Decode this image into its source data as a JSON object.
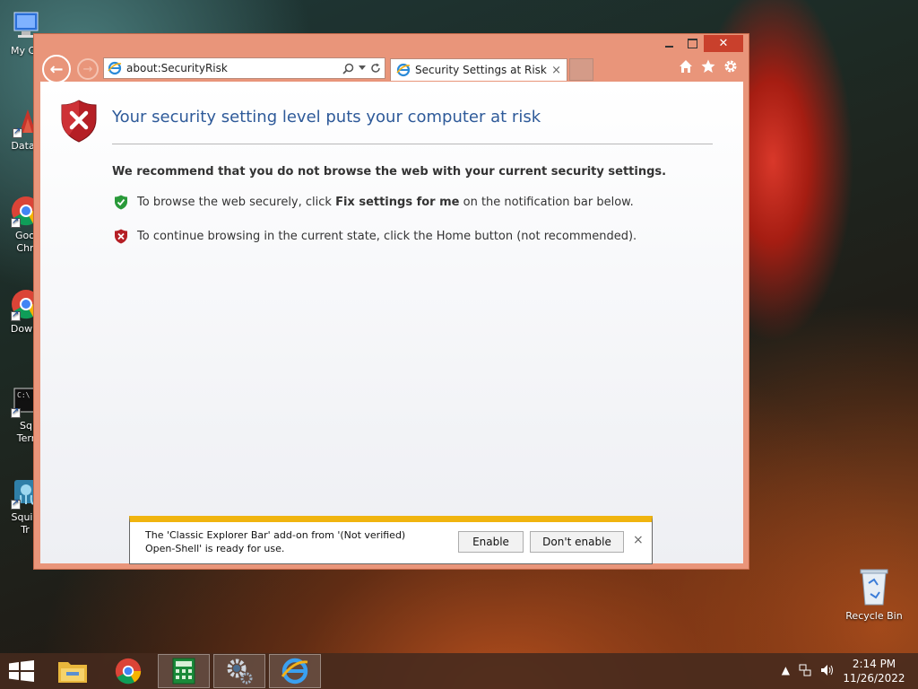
{
  "desktop": {
    "icons": [
      {
        "label": "My Co"
      },
      {
        "label": "DataW"
      },
      {
        "label": "Goo Chr"
      },
      {
        "label": "Downl"
      },
      {
        "label": "Sq Terr"
      },
      {
        "label": "Squid Tr"
      },
      {
        "label": "Recycle Bin"
      }
    ]
  },
  "browser": {
    "address": "about:SecurityRisk",
    "tab_title": "Security Settings at Risk",
    "tab_close": "×",
    "window_close": "✕",
    "back_glyph": "←",
    "forward_glyph": "→"
  },
  "page": {
    "title": "Your security setting level puts your computer at risk",
    "recommend": "We recommend that you do not browse the web with your current security settings.",
    "bullet1_pre": "To browse the web securely, click ",
    "bullet1_bold": "Fix settings for me",
    "bullet1_post": " on the notification bar below.",
    "bullet2": "To continue browsing in the current state, click the Home button (not recommended)."
  },
  "notification": {
    "message": "The 'Classic Explorer Bar' add-on from '(Not verified) Open-Shell' is ready for use.",
    "enable_label": "Enable",
    "dont_enable_label": "Don't enable",
    "close_glyph": "×"
  },
  "taskbar": {
    "time": "2:14 PM",
    "date": "11/26/2022"
  },
  "colors": {
    "window_frame": "#e9957a",
    "title_blue": "#2e5a99",
    "notification_accent": "#f0b40f",
    "close_red": "#c9402c"
  }
}
